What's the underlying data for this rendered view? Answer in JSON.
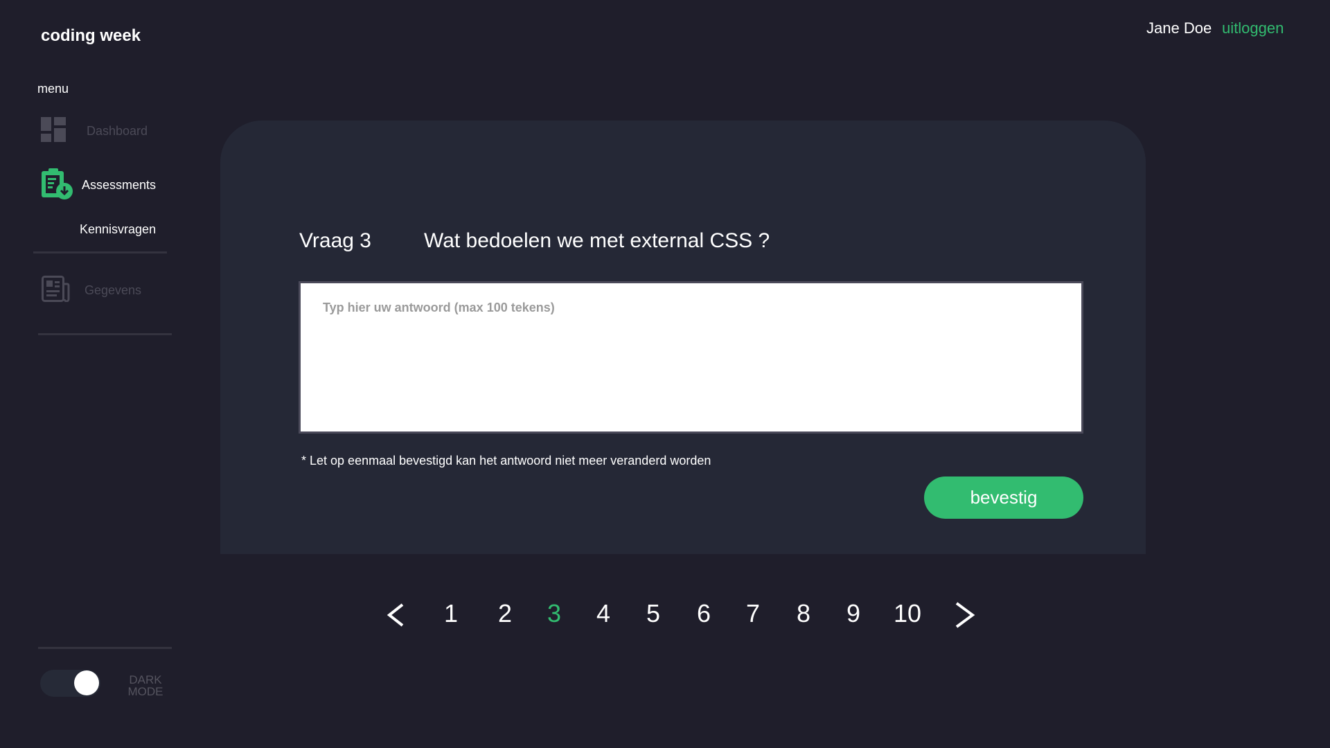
{
  "app": {
    "title": "coding week"
  },
  "sidebar": {
    "menu_label": "menu",
    "items": [
      {
        "label": "Dashboard",
        "icon": "dashboard-icon",
        "state": "inactive"
      },
      {
        "label": "Assessments",
        "icon": "clipboard-download-icon",
        "state": "active"
      },
      {
        "label": "Kennisvragen",
        "state": "active-sub"
      },
      {
        "label": "Gegevens",
        "icon": "newspaper-icon",
        "state": "inactive"
      }
    ],
    "dark_mode": {
      "label_line1": "DARK",
      "label_line2": "MODE",
      "on": true
    }
  },
  "header": {
    "user": "Jane Doe",
    "logout": "uitloggen"
  },
  "question": {
    "number_label": "Vraag 3",
    "text": "Wat bedoelen we met external CSS ?",
    "answer_value": "",
    "answer_placeholder": "Typ hier uw antwoord (max 100 tekens)",
    "note": "* Let op eenmaal bevestigd kan het antwoord niet meer veranderd worden",
    "confirm_label": "bevestig"
  },
  "pagination": {
    "prev": "<",
    "next": ">",
    "pages": [
      "1",
      "2",
      "3",
      "4",
      "5",
      "6",
      "7",
      "8",
      "9",
      "10"
    ],
    "current": 3
  },
  "colors": {
    "accent": "#32bc70",
    "background": "#1f1e2b",
    "card": "#252836",
    "muted": "#55545f"
  }
}
